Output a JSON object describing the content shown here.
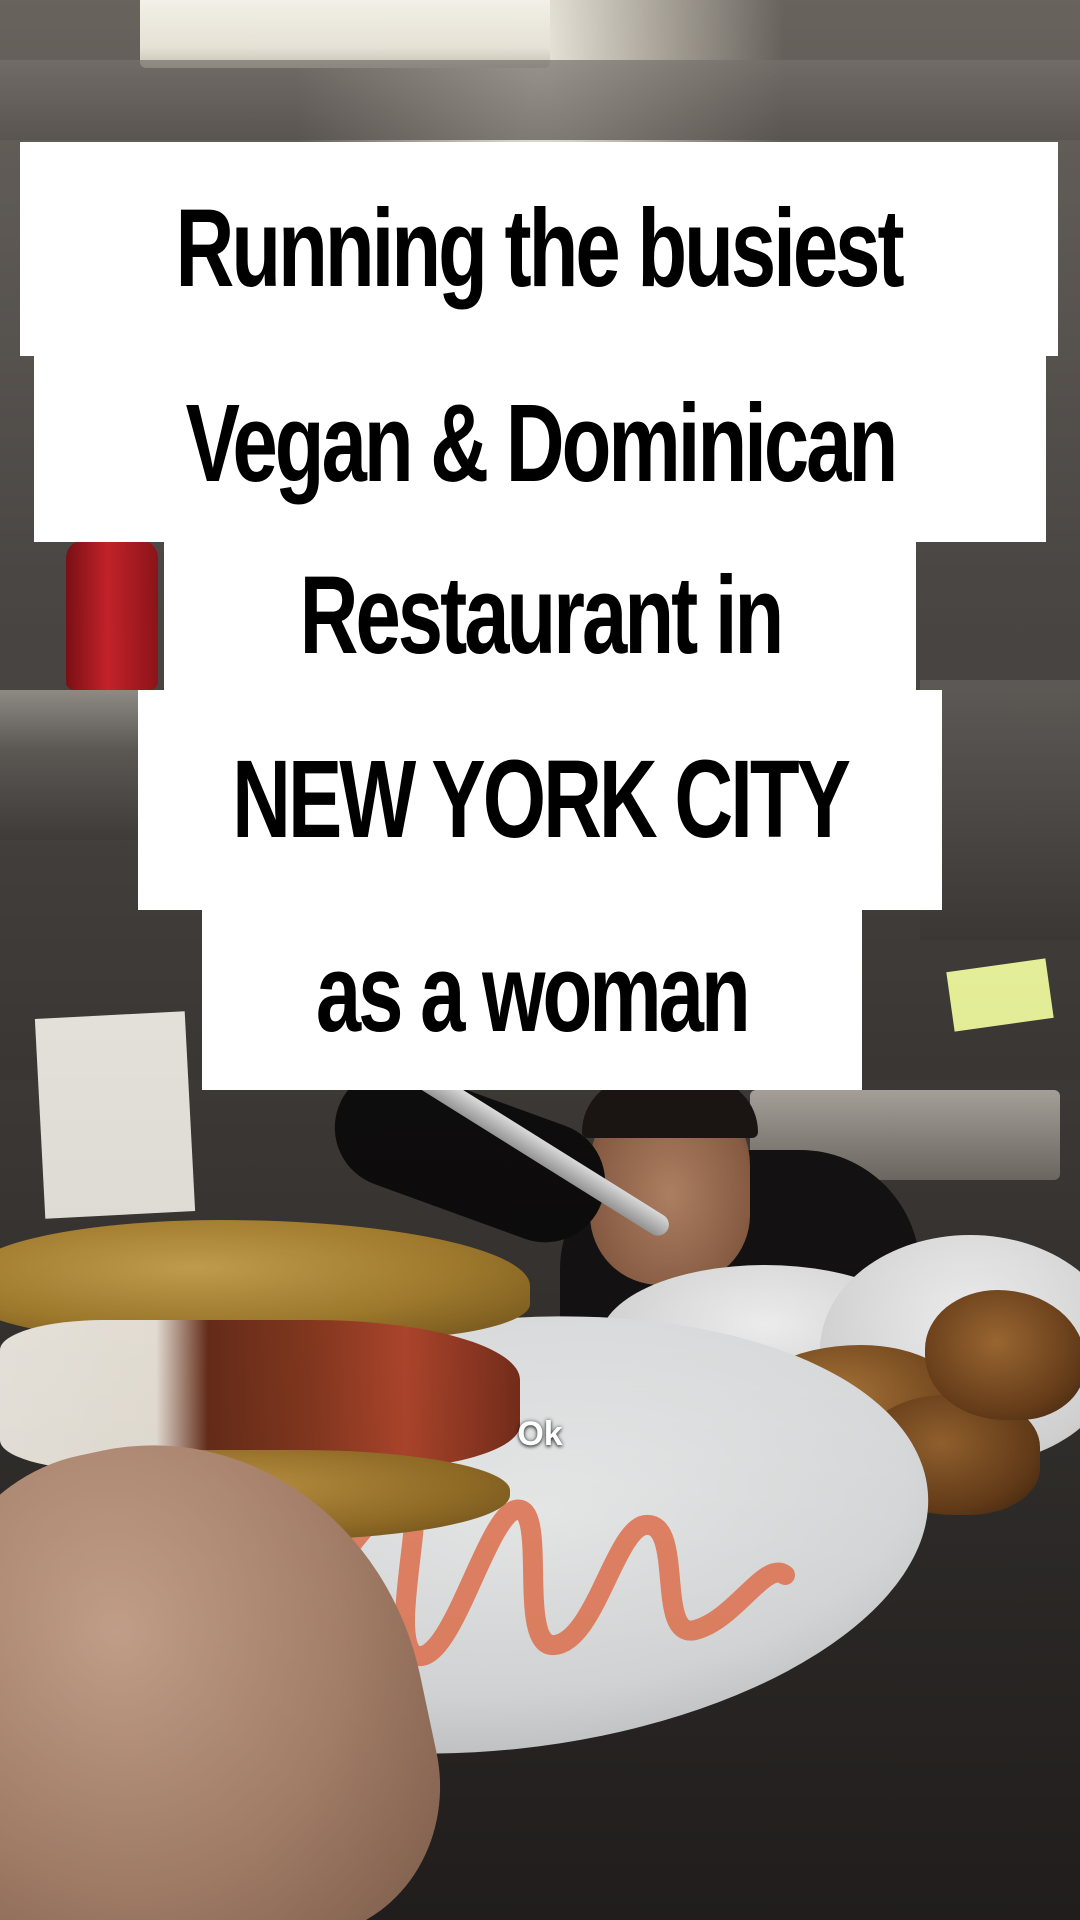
{
  "overlay_caption": {
    "line1": "Running the busiest",
    "line2": "Vegan & Dominican",
    "line3": "Restaurant in",
    "line4": "NEW YORK CITY",
    "line5": "as a woman"
  },
  "subtitle": "Ok",
  "colors": {
    "caption_background": "#ffffff",
    "caption_text": "#000000",
    "subtitle_text": "#ffffff",
    "sauce": "#f08a6a"
  }
}
